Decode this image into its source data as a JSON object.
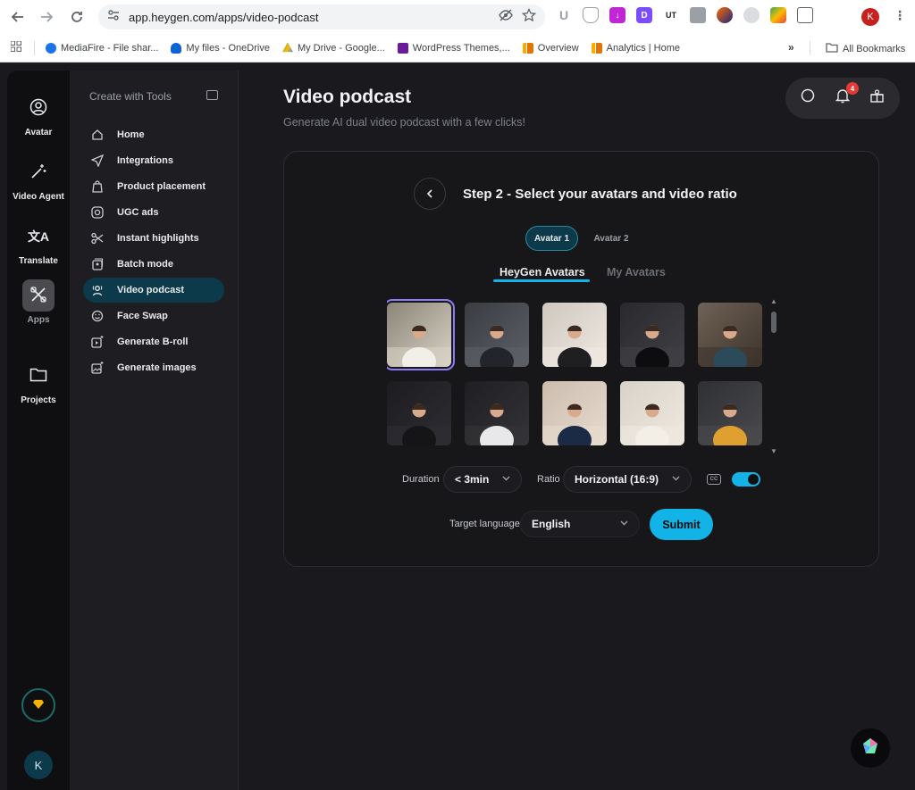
{
  "browser": {
    "url": "app.heygen.com/apps/video-podcast",
    "profile_initial": "K",
    "bookmarks": [
      {
        "label": "MediaFire - File shar...",
        "color": "#1a73e8"
      },
      {
        "label": "My files - OneDrive",
        "color": "#0a64d6"
      },
      {
        "label": "My Drive - Google...",
        "color": "#fbbc04"
      },
      {
        "label": "WordPress Themes,...",
        "color": "#6a1b9a"
      },
      {
        "label": "Overview",
        "color": "#f9ab00"
      },
      {
        "label": "Analytics | Home",
        "color": "#e37400"
      }
    ],
    "all_bookmarks": "All Bookmarks"
  },
  "rail": {
    "items": [
      {
        "label": "Avatar"
      },
      {
        "label": "Video Agent"
      },
      {
        "label": "Translate"
      },
      {
        "label": "Apps"
      },
      {
        "label": "Projects"
      }
    ],
    "avatar_initial": "K"
  },
  "tools": {
    "heading": "Create with Tools",
    "items": [
      {
        "label": "Home",
        "icon": "home-icon"
      },
      {
        "label": "Integrations",
        "icon": "send-icon"
      },
      {
        "label": "Product placement",
        "icon": "bag-icon"
      },
      {
        "label": "UGC ads",
        "icon": "instagram-icon"
      },
      {
        "label": "Instant highlights",
        "icon": "scissors-icon"
      },
      {
        "label": "Batch mode",
        "icon": "batch-icon"
      },
      {
        "label": "Video podcast",
        "icon": "podcast-icon"
      },
      {
        "label": "Face Swap",
        "icon": "face-icon"
      },
      {
        "label": "Generate B-roll",
        "icon": "broll-icon"
      },
      {
        "label": "Generate images",
        "icon": "image-icon"
      }
    ]
  },
  "main": {
    "title": "Video podcast",
    "subtitle": "Generate AI dual video podcast with a few clicks!",
    "notification_count": "4"
  },
  "card": {
    "step_title": "Step 2 - Select your avatars and video ratio",
    "avatar_tabs": [
      "Avatar 1",
      "Avatar 2"
    ],
    "source_tabs": [
      "HeyGen Avatars",
      "My Avatars"
    ],
    "duration_label": "Duration",
    "duration_value": "< 3min",
    "ratio_label": "Ratio",
    "ratio_value": "Horizontal (16:9)",
    "cc_label": "CC",
    "language_label": "Target language",
    "language_value": "English",
    "submit_label": "Submit"
  },
  "colors": {
    "accent": "#12b3e6",
    "selected_outline": "#8b7cf6",
    "active_tool": "#0d3a4a"
  }
}
